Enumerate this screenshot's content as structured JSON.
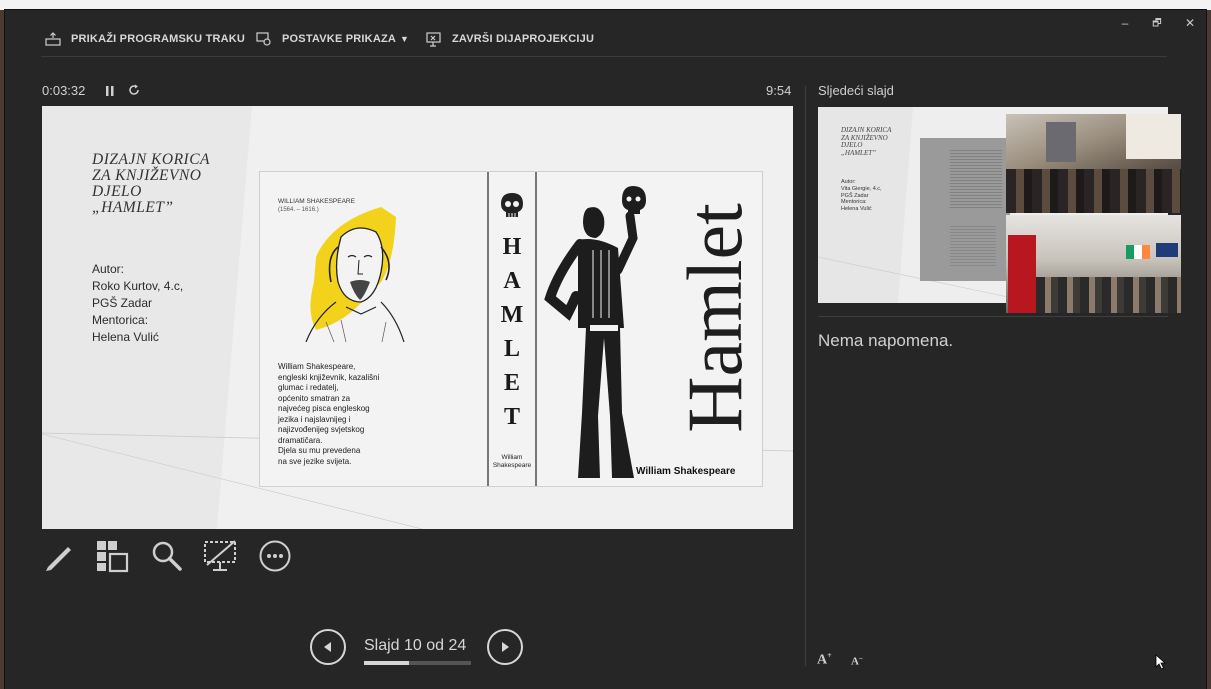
{
  "toolbar": {
    "show_ribbon": "PRIKAŽI PROGRAMSKU TRAKU",
    "display_settings": "POSTAVKE PRIKAZA",
    "end_slideshow": "ZAVRŠI DIJAPROJEKCIJU"
  },
  "window_controls": {
    "minimize": "–",
    "restore": "🗗",
    "close": "✕"
  },
  "timer": {
    "elapsed": "0:03:32",
    "clock": "9:54"
  },
  "next_slide": {
    "heading": "Sljedeći slajd",
    "title": "DIZAJN KORICA\nZA KNJIŽEVNO\nDJELO\n„HAMLET”",
    "author": "Autor:\nVita Giergie, 4.c,\nPGŠ Zadar\nMentorica:\nHelena Vulić"
  },
  "notes": {
    "text": "Nema napomena."
  },
  "slide": {
    "title": "DIZAJN KORICA\nZA KNJIŽEVNO\nDJELO\n„HAMLET”",
    "author": "Autor:\nRoko Kurtov, 4.c,\nPGŠ Zadar\nMentorica:\nHelena Vulić",
    "cover": {
      "portrait_name": "WILLIAM  SHAKESPEARE",
      "portrait_years": "(1564. – 1616.)",
      "bio": "William Shakespeare,\nengleski književnik, kazališni\nglumac i redatelj,\nopćenito smatran za\nnajvećeg pisca engleskog\njezika i najslavnijeg i\nnajizvođenijeg svjetskog\ndramatičara.\nDjela su mu prevedena\nna sve jezike svijeta.",
      "spine_letters": [
        "H",
        "A",
        "M",
        "L",
        "E",
        "T"
      ],
      "spine_author": "William\nShakespeare",
      "front_title": "Hamlet",
      "front_author": "William Shakespeare",
      "accent_color": "#f2d21b"
    }
  },
  "navigation": {
    "label": "Slajd 10 od 24",
    "current": 10,
    "total": 24,
    "progress_fraction": 0.417
  },
  "icons": {
    "tools": [
      "pen-icon",
      "see-all-slides-icon",
      "zoom-icon",
      "black-screen-icon",
      "more-options-icon"
    ],
    "nav": [
      "previous-arrow-icon",
      "next-arrow-icon"
    ],
    "font_size": [
      "increase-font-icon",
      "decrease-font-icon"
    ]
  }
}
